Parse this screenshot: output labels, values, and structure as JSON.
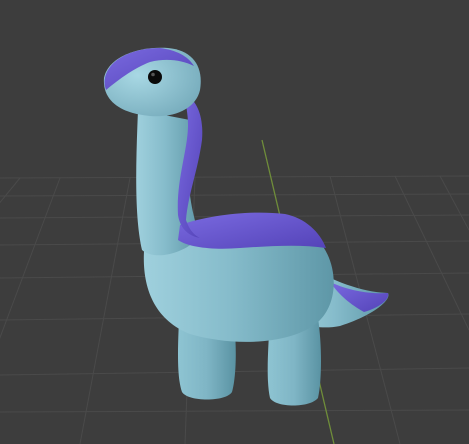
{
  "viewport": {
    "background_color": "#3d3d3d",
    "grid_line_color": "#4a4a4a",
    "grid_line_color_dim": "#444444",
    "y_axis_color": "#6f8d3a",
    "grid_visible": true
  },
  "object": {
    "kind": "dinosaur",
    "body_color": "#87bccb",
    "body_shadow_color": "#5f98a8",
    "body_highlight_color": "#aad6e2",
    "accent_color": "#6a5acd",
    "eye_color": "#000000"
  }
}
